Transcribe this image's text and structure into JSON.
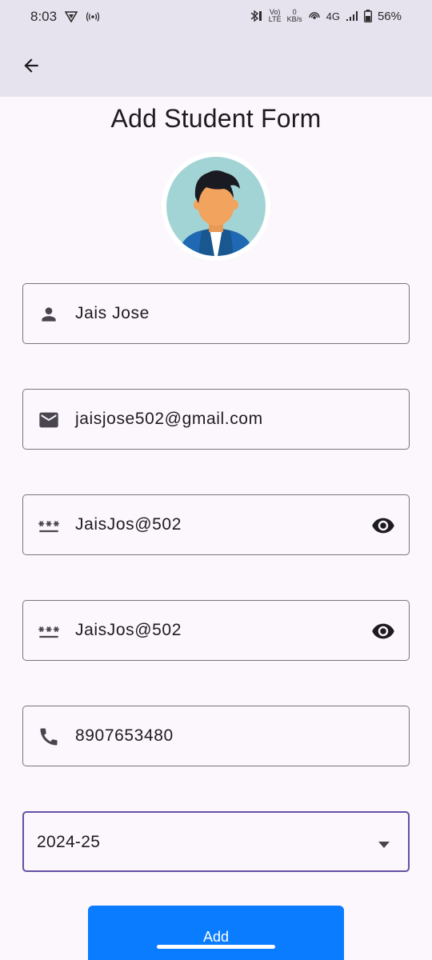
{
  "status_bar": {
    "time": "8:03",
    "volte": "Vo)\nLTE",
    "net_speed_value": "0",
    "net_speed_unit": "KB/s",
    "network_type": "4G",
    "battery": "56%"
  },
  "title": "Add Student Form",
  "form": {
    "name": {
      "value": "Jais Jose",
      "icon": "person-icon"
    },
    "email": {
      "value": "jaisjose502@gmail.com",
      "icon": "mail-icon"
    },
    "password": {
      "value": "JaisJos@502",
      "icon": "password-icon",
      "toggle_icon": "visibility-icon"
    },
    "confirm_password": {
      "value": "JaisJos@502",
      "icon": "password-icon",
      "toggle_icon": "visibility-icon"
    },
    "phone": {
      "value": "8907653480",
      "icon": "phone-icon"
    },
    "year": {
      "selected": "2024-25",
      "icon": "arrow-drop-down-icon"
    }
  },
  "add_button_label": "Add",
  "colors": {
    "app_bar": "#e6e3ef",
    "background": "#fcf7fd",
    "outline": "#79747e",
    "focus": "#6750a4",
    "primary_button": "#0a7cff"
  }
}
